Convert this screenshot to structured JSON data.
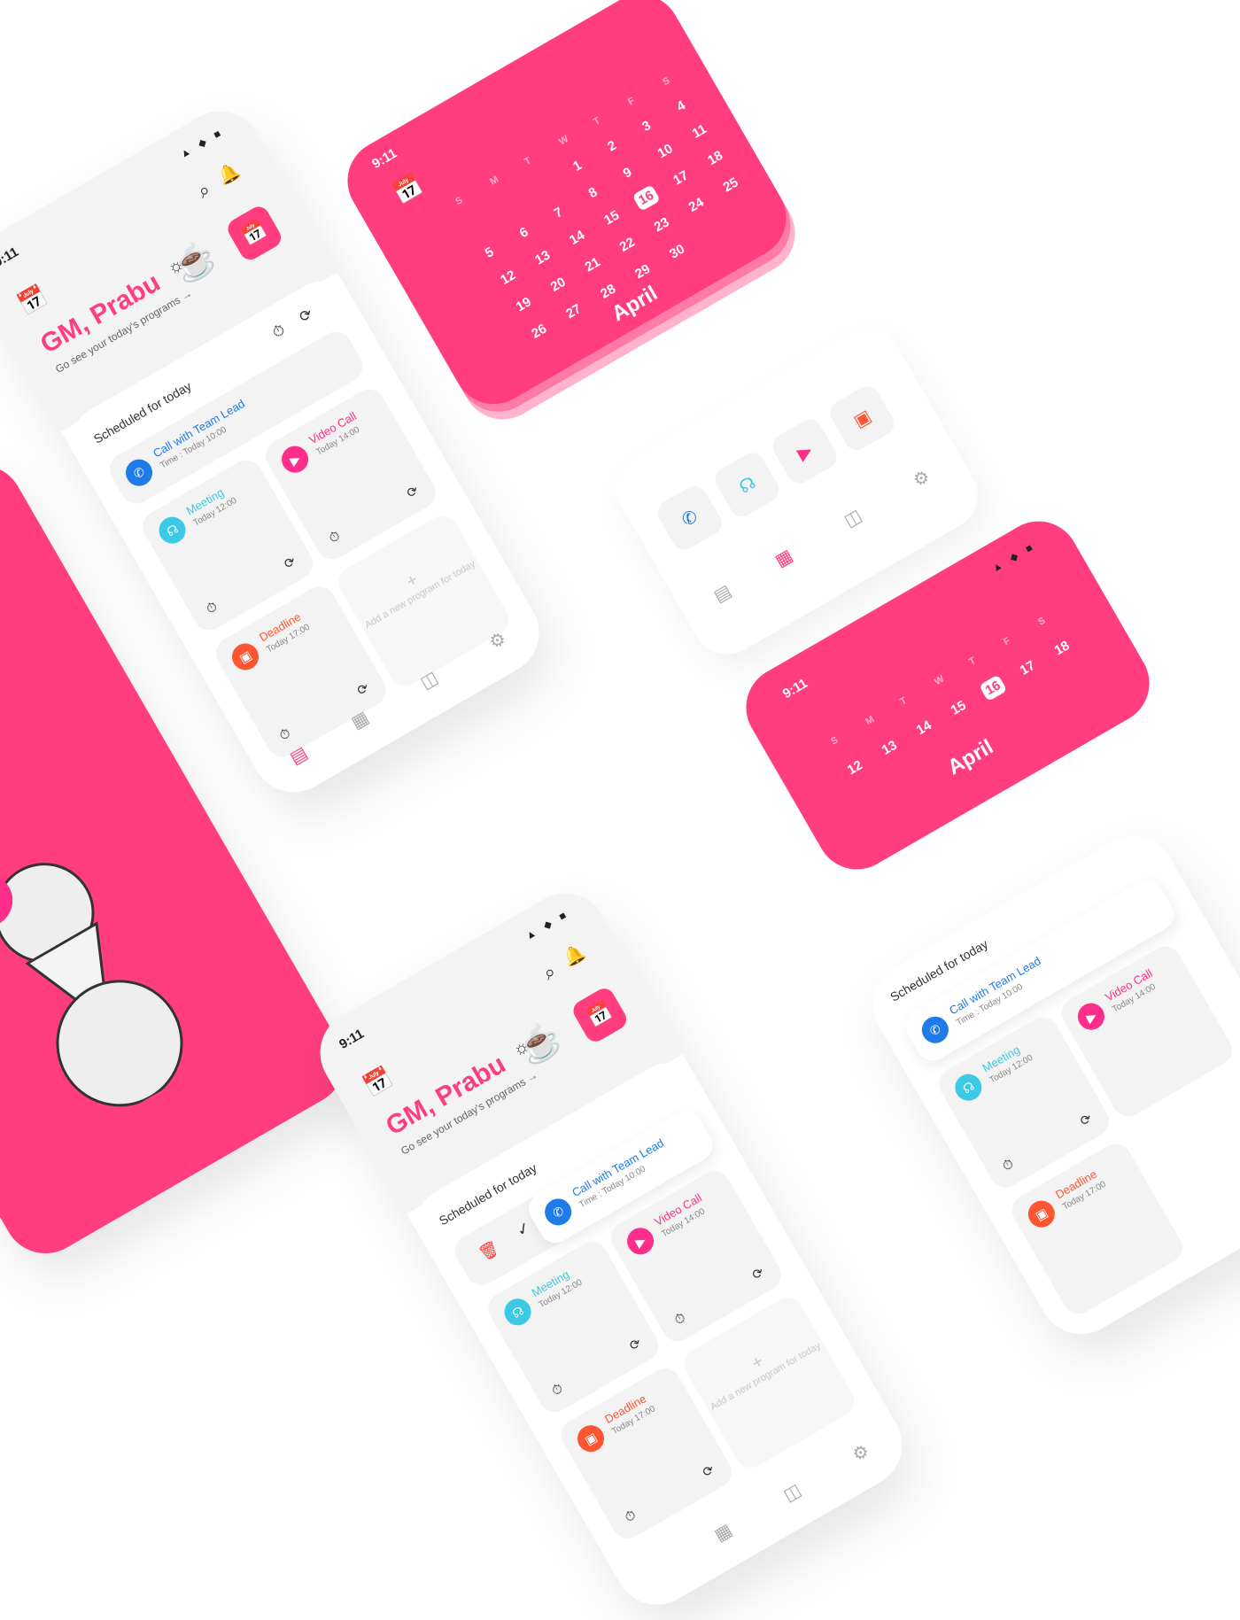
{
  "status": {
    "time": "9:11",
    "icons": "▲ ◆ ■"
  },
  "home": {
    "greeting": "GM, Prabu",
    "subtitle": "Go see your today's programs →",
    "schedule_label": "Scheduled for today",
    "add_card": "Add a new program for today",
    "tasks": [
      {
        "title": "Call with Team Lead",
        "time": "Time : Today 10:00",
        "color": "#1e7be8"
      },
      {
        "title": "Video Call",
        "time": "Today 14:00",
        "color": "#ff2e8a"
      },
      {
        "title": "Meeting",
        "time": "Today 12:00",
        "color": "#3cc9e6"
      },
      {
        "title": "Deadline",
        "time": "Today 17:00",
        "color": "#ff5533"
      }
    ]
  },
  "calendar": {
    "month": "April",
    "selected": "16",
    "weekdays": [
      "S",
      "M",
      "T",
      "W",
      "T",
      "F",
      "S"
    ],
    "dates": [
      "1",
      "2",
      "3",
      "4",
      "5",
      "6",
      "7",
      "8",
      "9",
      "10",
      "11",
      "12",
      "13",
      "14",
      "15",
      "16",
      "17",
      "18",
      "19",
      "20",
      "21",
      "22",
      "23",
      "24",
      "25",
      "26",
      "27",
      "28",
      "29",
      "30"
    ]
  },
  "onboard": {
    "arrow": "→"
  },
  "colors": {
    "accent": "#ff3d7f",
    "background": "#ffffff",
    "card": "#f3f3f3"
  }
}
